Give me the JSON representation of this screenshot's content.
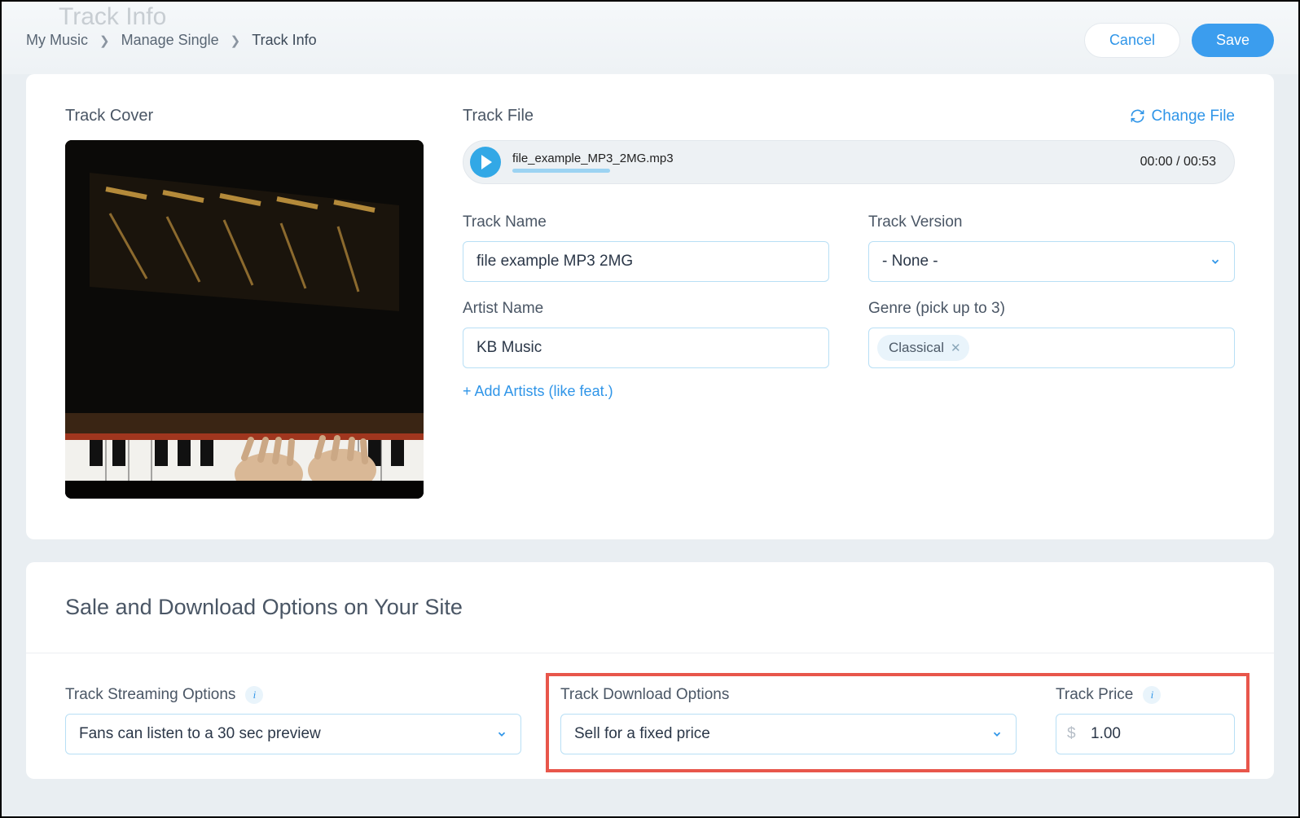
{
  "faded_title": "Track Info",
  "breadcrumb": {
    "item1": "My Music",
    "item2": "Manage Single",
    "current": "Track Info"
  },
  "header": {
    "cancel": "Cancel",
    "save": "Save"
  },
  "cover": {
    "label": "Track Cover"
  },
  "file": {
    "label": "Track File",
    "change": "Change File",
    "file_name": "file_example_MP3_2MG.mp3",
    "time": "00:00 / 00:53"
  },
  "fields": {
    "track_name_label": "Track Name",
    "track_name_value": "file example MP3 2MG",
    "version_label": "Track Version",
    "version_value": "- None -",
    "artist_label": "Artist Name",
    "artist_value": "KB Music",
    "add_artists": "+ Add Artists (like feat.)",
    "genre_label": "Genre (pick up to 3)",
    "genre_tag": "Classical"
  },
  "sale": {
    "title": "Sale and Download Options on Your Site",
    "streaming_label": "Track Streaming Options",
    "streaming_value": "Fans can listen to a 30 sec preview",
    "download_label": "Track Download Options",
    "download_value": "Sell for a fixed price",
    "price_label": "Track Price",
    "price_value": "1.00"
  }
}
